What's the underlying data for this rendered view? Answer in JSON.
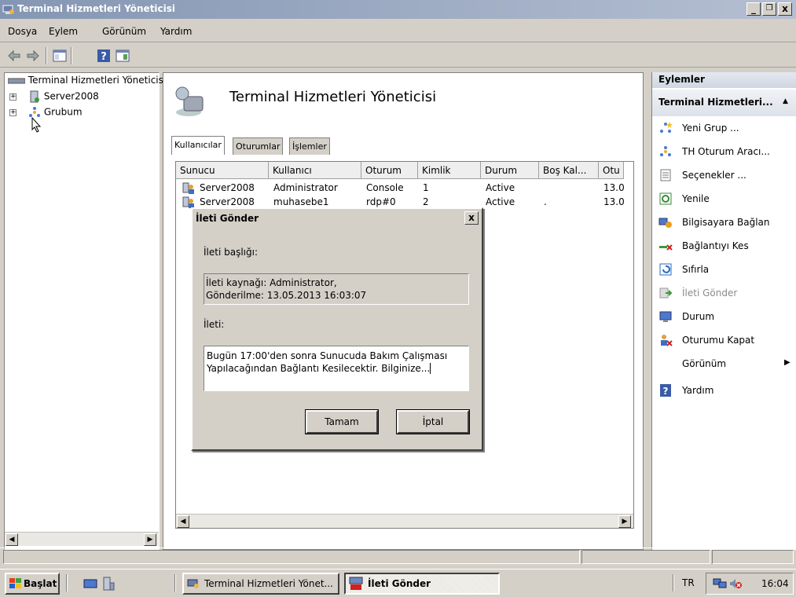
{
  "window": {
    "title": "Terminal Hizmetleri Yöneticisi",
    "min": "_",
    "max": "❐",
    "close": "x"
  },
  "menu": [
    "Dosya",
    "Eylem",
    "Görünüm",
    "Yardım"
  ],
  "tree": {
    "root": "Terminal Hizmetleri Yöneticisi",
    "items": [
      "Server2008",
      "Grubum"
    ]
  },
  "header": {
    "title": "Terminal Hizmetleri Yöneticisi"
  },
  "tabs": [
    "Kullanıcılar",
    "Oturumlar",
    "İşlemler"
  ],
  "table": {
    "columns": [
      "Sunucu",
      "Kullanıcı",
      "Oturum",
      "Kimlik",
      "Durum",
      "Boş Kal...",
      "Otu"
    ],
    "rows": [
      [
        "Server2008",
        "Administrator",
        "Console",
        "1",
        "Active",
        "",
        "13.0"
      ],
      [
        "Server2008",
        "muhasebe1",
        "rdp#0",
        "2",
        "Active",
        ".",
        "13.0"
      ]
    ]
  },
  "dialog": {
    "title": "İleti Gönder",
    "close": "x",
    "subject_label": "İleti başlığı:",
    "source_line1": "İleti kaynağı: Administrator,",
    "source_line2": "Gönderilme: 13.05.2013 16:03:07",
    "message_label": "İleti:",
    "message_line1": "Bugün 17:00'den sonra Sunucuda Bakım Çalışması",
    "message_line2": "Yapılacağından Bağlantı Kesilecektir. Bilginize...",
    "ok": "Tamam",
    "cancel": "İptal"
  },
  "actions": {
    "header": "Eylemler",
    "section": "Terminal Hizmetleri...",
    "items": [
      "Yeni Grup ...",
      "TH Oturum Aracı...",
      "Seçenekler ...",
      "Yenile",
      "Bilgisayara Bağlan",
      "Bağlantıyı Kes",
      "Sıfırla",
      "İleti Gönder",
      "Durum",
      "Oturumu Kapat",
      "Görünüm",
      "Yardım"
    ]
  },
  "taskbar": {
    "start": "Başlat",
    "task1": "Terminal Hizmetleri Yönet...",
    "task2": "İleti Gönder",
    "lang": "TR",
    "clock": "16:04"
  }
}
